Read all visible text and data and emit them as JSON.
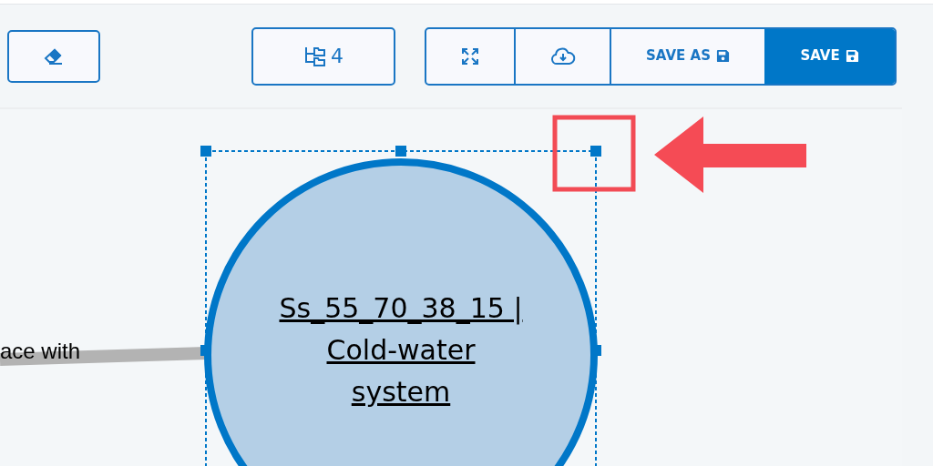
{
  "toolbar": {
    "clear_button": {
      "kind": "eraser"
    },
    "layers_button": {
      "label": "4"
    },
    "actions": [
      {
        "kind": "fit",
        "primary": false
      },
      {
        "kind": "download",
        "primary": false
      },
      {
        "kind": "save",
        "label": "SAVE AS",
        "primary": false
      },
      {
        "kind": "save",
        "label": "SAVE",
        "primary": true
      }
    ]
  },
  "canvas": {
    "connector_label": "ace with",
    "node": {
      "lines": [
        "Ss_55_70_38_15 |",
        "Cold-water",
        "system"
      ],
      "selected": true
    }
  }
}
